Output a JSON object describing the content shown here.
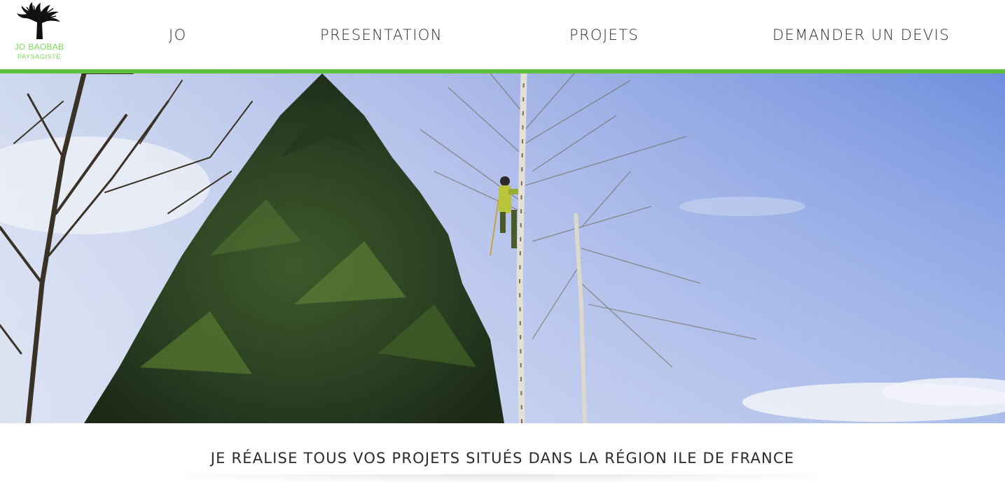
{
  "logo": {
    "name": "JO BAOBAB",
    "subtitle": "PAYSAGISTE",
    "icon": "baobab-tree-icon"
  },
  "nav": {
    "items": [
      {
        "label": "JO"
      },
      {
        "label": "PRESENTATION"
      },
      {
        "label": "PROJETS"
      },
      {
        "label": "DEMANDER UN DEVIS"
      }
    ]
  },
  "hero": {
    "subject": "arborist-climbing-birch-tree"
  },
  "tagline": "JE RÉALISE TOUS VOS PROJETS SITUÉS DANS LA RÉGION ILE DE FRANCE",
  "colors": {
    "accent": "#5fbf3f",
    "logo_text": "#7ed957",
    "text": "#2b2b2b",
    "sky": "#8fa8e6"
  }
}
